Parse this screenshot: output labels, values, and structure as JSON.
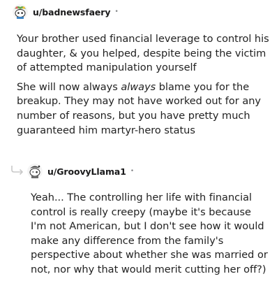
{
  "comment1": {
    "username": "u/badnewsfaery",
    "separator": "•",
    "paragraph1": "Your brother used financial leverage to control his daughter, & you helped, despite being the victim of attempted manipulation yourself",
    "p2_before": "She will now always ",
    "p2_emph": "always",
    "p2_after": " blame you for the breakup. They may not have worked out for any number of reasons, but you have pretty much guaranteed him martyr-hero status"
  },
  "comment2": {
    "username": "u/GroovyLlama1",
    "separator": "•",
    "paragraph1": "Yeah... The controlling her life with financial control is really creepy (maybe it's because I'm not American, but I don't see how it would make any difference from the family's perspective about whether she was married or not, nor why that would merit cutting her off?)"
  },
  "icons": {
    "avatar1": "reddit-snoo-avatar-icon",
    "avatar2": "reddit-snoo-avatar-icon",
    "reply": "reply-arrow-icon"
  }
}
